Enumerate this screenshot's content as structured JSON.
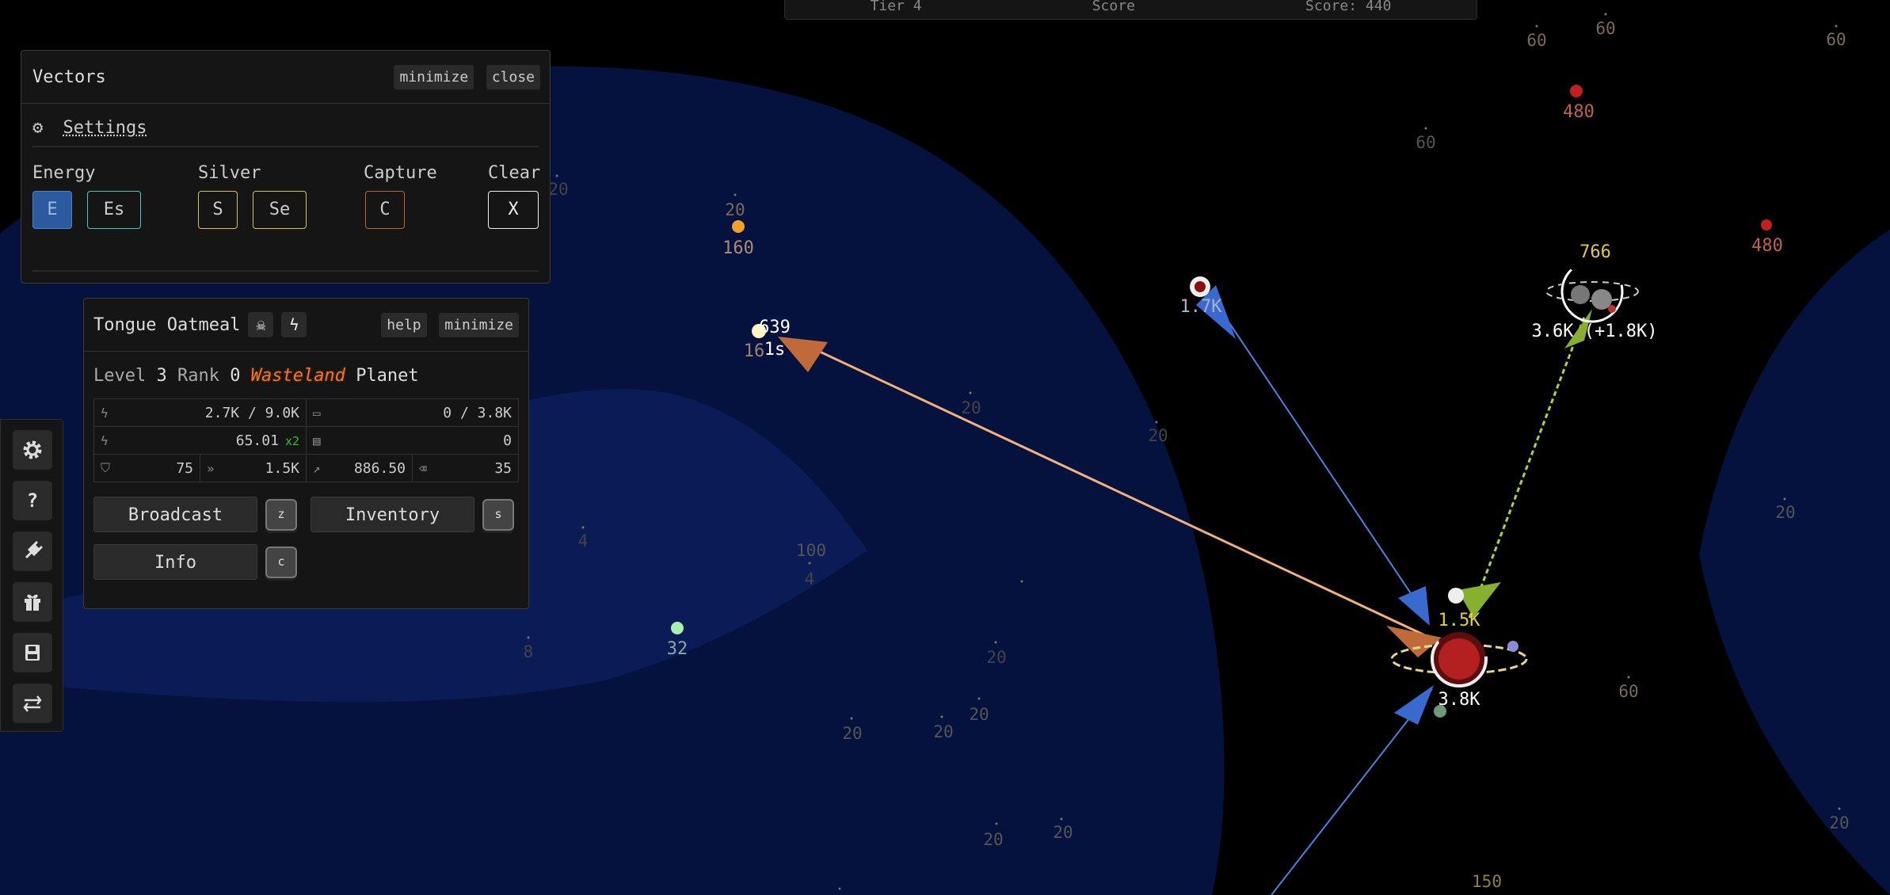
{
  "topbar": {
    "left": "Tier 4",
    "center": "Score",
    "right": "Score: 440"
  },
  "vectors_pane": {
    "title": "Vectors",
    "minimize_label": "minimize",
    "close_label": "close",
    "settings_label": "Settings",
    "groups": [
      {
        "label": "Energy",
        "buttons": [
          "E",
          "Es"
        ]
      },
      {
        "label": "Silver",
        "buttons": [
          "S",
          "Se"
        ]
      },
      {
        "label": "Capture",
        "buttons": [
          "C"
        ]
      },
      {
        "label": "Clear",
        "buttons": [
          "X"
        ]
      }
    ]
  },
  "planet_pane": {
    "name": "Tongue Oatmeal",
    "help_label": "help",
    "minimize_label": "minimize",
    "level_label": "Level",
    "level": "3",
    "rank_label": "Rank",
    "rank": "0",
    "biome": "Wasteland",
    "type": "Planet",
    "stats": {
      "energy": "2.7K",
      "energy_cap": "9.0K",
      "silver": "0",
      "silver_cap": "3.8K",
      "energy_growth": "65.01",
      "growth_mult": "x2",
      "silver_growth": "0",
      "defense": "75",
      "speed": "1.5K",
      "range": "886.50",
      "junk": "35"
    },
    "actions": [
      {
        "label": "Broadcast",
        "key": "z"
      },
      {
        "label": "Inventory",
        "key": "s"
      },
      {
        "label": "Info",
        "key": "c"
      }
    ]
  },
  "toolbar_icons": [
    "gear-icon",
    "help-icon",
    "plugin-icon",
    "gift-icon",
    "save-icon",
    "transfer-icon"
  ],
  "map": {
    "planets": [
      {
        "label": "639",
        "color": "#fff6c2"
      },
      {
        "label": "160",
        "color": "#f0a030"
      },
      {
        "label": "32",
        "color": "#a8f0b0"
      },
      {
        "label": "1.7K",
        "color": "#ddd"
      },
      {
        "label": "766",
        "color": "#e0c94a"
      },
      {
        "label": "3.6K (+1.8K)",
        "color": "#fff"
      },
      {
        "label": "480",
        "color": "#d04030"
      },
      {
        "label": "480",
        "color": "#d04030"
      },
      {
        "label": "1.5K",
        "color": "#e0d040"
      },
      {
        "label": "3.8K",
        "color": "#fff"
      }
    ],
    "timer": "1s",
    "timer_value": "16",
    "asteroid_levels": [
      "60",
      "60",
      "60",
      "60",
      "20",
      "20",
      "20",
      "20",
      "100",
      "4",
      "4",
      "8",
      "20",
      "20",
      "20",
      "20",
      "20",
      "20",
      "20",
      "60",
      "20",
      "150",
      "20"
    ]
  }
}
